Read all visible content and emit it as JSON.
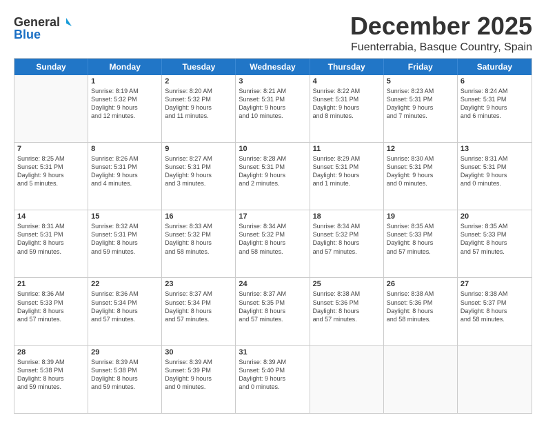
{
  "logo": {
    "general": "General",
    "blue": "Blue"
  },
  "title": "December 2025",
  "subtitle": "Fuenterrabia, Basque Country, Spain",
  "header_days": [
    "Sunday",
    "Monday",
    "Tuesday",
    "Wednesday",
    "Thursday",
    "Friday",
    "Saturday"
  ],
  "weeks": [
    [
      {
        "day": "",
        "info": ""
      },
      {
        "day": "1",
        "info": "Sunrise: 8:19 AM\nSunset: 5:32 PM\nDaylight: 9 hours\nand 12 minutes."
      },
      {
        "day": "2",
        "info": "Sunrise: 8:20 AM\nSunset: 5:32 PM\nDaylight: 9 hours\nand 11 minutes."
      },
      {
        "day": "3",
        "info": "Sunrise: 8:21 AM\nSunset: 5:31 PM\nDaylight: 9 hours\nand 10 minutes."
      },
      {
        "day": "4",
        "info": "Sunrise: 8:22 AM\nSunset: 5:31 PM\nDaylight: 9 hours\nand 8 minutes."
      },
      {
        "day": "5",
        "info": "Sunrise: 8:23 AM\nSunset: 5:31 PM\nDaylight: 9 hours\nand 7 minutes."
      },
      {
        "day": "6",
        "info": "Sunrise: 8:24 AM\nSunset: 5:31 PM\nDaylight: 9 hours\nand 6 minutes."
      }
    ],
    [
      {
        "day": "7",
        "info": "Sunrise: 8:25 AM\nSunset: 5:31 PM\nDaylight: 9 hours\nand 5 minutes."
      },
      {
        "day": "8",
        "info": "Sunrise: 8:26 AM\nSunset: 5:31 PM\nDaylight: 9 hours\nand 4 minutes."
      },
      {
        "day": "9",
        "info": "Sunrise: 8:27 AM\nSunset: 5:31 PM\nDaylight: 9 hours\nand 3 minutes."
      },
      {
        "day": "10",
        "info": "Sunrise: 8:28 AM\nSunset: 5:31 PM\nDaylight: 9 hours\nand 2 minutes."
      },
      {
        "day": "11",
        "info": "Sunrise: 8:29 AM\nSunset: 5:31 PM\nDaylight: 9 hours\nand 1 minute."
      },
      {
        "day": "12",
        "info": "Sunrise: 8:30 AM\nSunset: 5:31 PM\nDaylight: 9 hours\nand 0 minutes."
      },
      {
        "day": "13",
        "info": "Sunrise: 8:31 AM\nSunset: 5:31 PM\nDaylight: 9 hours\nand 0 minutes."
      }
    ],
    [
      {
        "day": "14",
        "info": "Sunrise: 8:31 AM\nSunset: 5:31 PM\nDaylight: 8 hours\nand 59 minutes."
      },
      {
        "day": "15",
        "info": "Sunrise: 8:32 AM\nSunset: 5:31 PM\nDaylight: 8 hours\nand 59 minutes."
      },
      {
        "day": "16",
        "info": "Sunrise: 8:33 AM\nSunset: 5:32 PM\nDaylight: 8 hours\nand 58 minutes."
      },
      {
        "day": "17",
        "info": "Sunrise: 8:34 AM\nSunset: 5:32 PM\nDaylight: 8 hours\nand 58 minutes."
      },
      {
        "day": "18",
        "info": "Sunrise: 8:34 AM\nSunset: 5:32 PM\nDaylight: 8 hours\nand 57 minutes."
      },
      {
        "day": "19",
        "info": "Sunrise: 8:35 AM\nSunset: 5:33 PM\nDaylight: 8 hours\nand 57 minutes."
      },
      {
        "day": "20",
        "info": "Sunrise: 8:35 AM\nSunset: 5:33 PM\nDaylight: 8 hours\nand 57 minutes."
      }
    ],
    [
      {
        "day": "21",
        "info": "Sunrise: 8:36 AM\nSunset: 5:33 PM\nDaylight: 8 hours\nand 57 minutes."
      },
      {
        "day": "22",
        "info": "Sunrise: 8:36 AM\nSunset: 5:34 PM\nDaylight: 8 hours\nand 57 minutes."
      },
      {
        "day": "23",
        "info": "Sunrise: 8:37 AM\nSunset: 5:34 PM\nDaylight: 8 hours\nand 57 minutes."
      },
      {
        "day": "24",
        "info": "Sunrise: 8:37 AM\nSunset: 5:35 PM\nDaylight: 8 hours\nand 57 minutes."
      },
      {
        "day": "25",
        "info": "Sunrise: 8:38 AM\nSunset: 5:36 PM\nDaylight: 8 hours\nand 57 minutes."
      },
      {
        "day": "26",
        "info": "Sunrise: 8:38 AM\nSunset: 5:36 PM\nDaylight: 8 hours\nand 58 minutes."
      },
      {
        "day": "27",
        "info": "Sunrise: 8:38 AM\nSunset: 5:37 PM\nDaylight: 8 hours\nand 58 minutes."
      }
    ],
    [
      {
        "day": "28",
        "info": "Sunrise: 8:39 AM\nSunset: 5:38 PM\nDaylight: 8 hours\nand 59 minutes."
      },
      {
        "day": "29",
        "info": "Sunrise: 8:39 AM\nSunset: 5:38 PM\nDaylight: 8 hours\nand 59 minutes."
      },
      {
        "day": "30",
        "info": "Sunrise: 8:39 AM\nSunset: 5:39 PM\nDaylight: 9 hours\nand 0 minutes."
      },
      {
        "day": "31",
        "info": "Sunrise: 8:39 AM\nSunset: 5:40 PM\nDaylight: 9 hours\nand 0 minutes."
      },
      {
        "day": "",
        "info": ""
      },
      {
        "day": "",
        "info": ""
      },
      {
        "day": "",
        "info": ""
      }
    ]
  ]
}
